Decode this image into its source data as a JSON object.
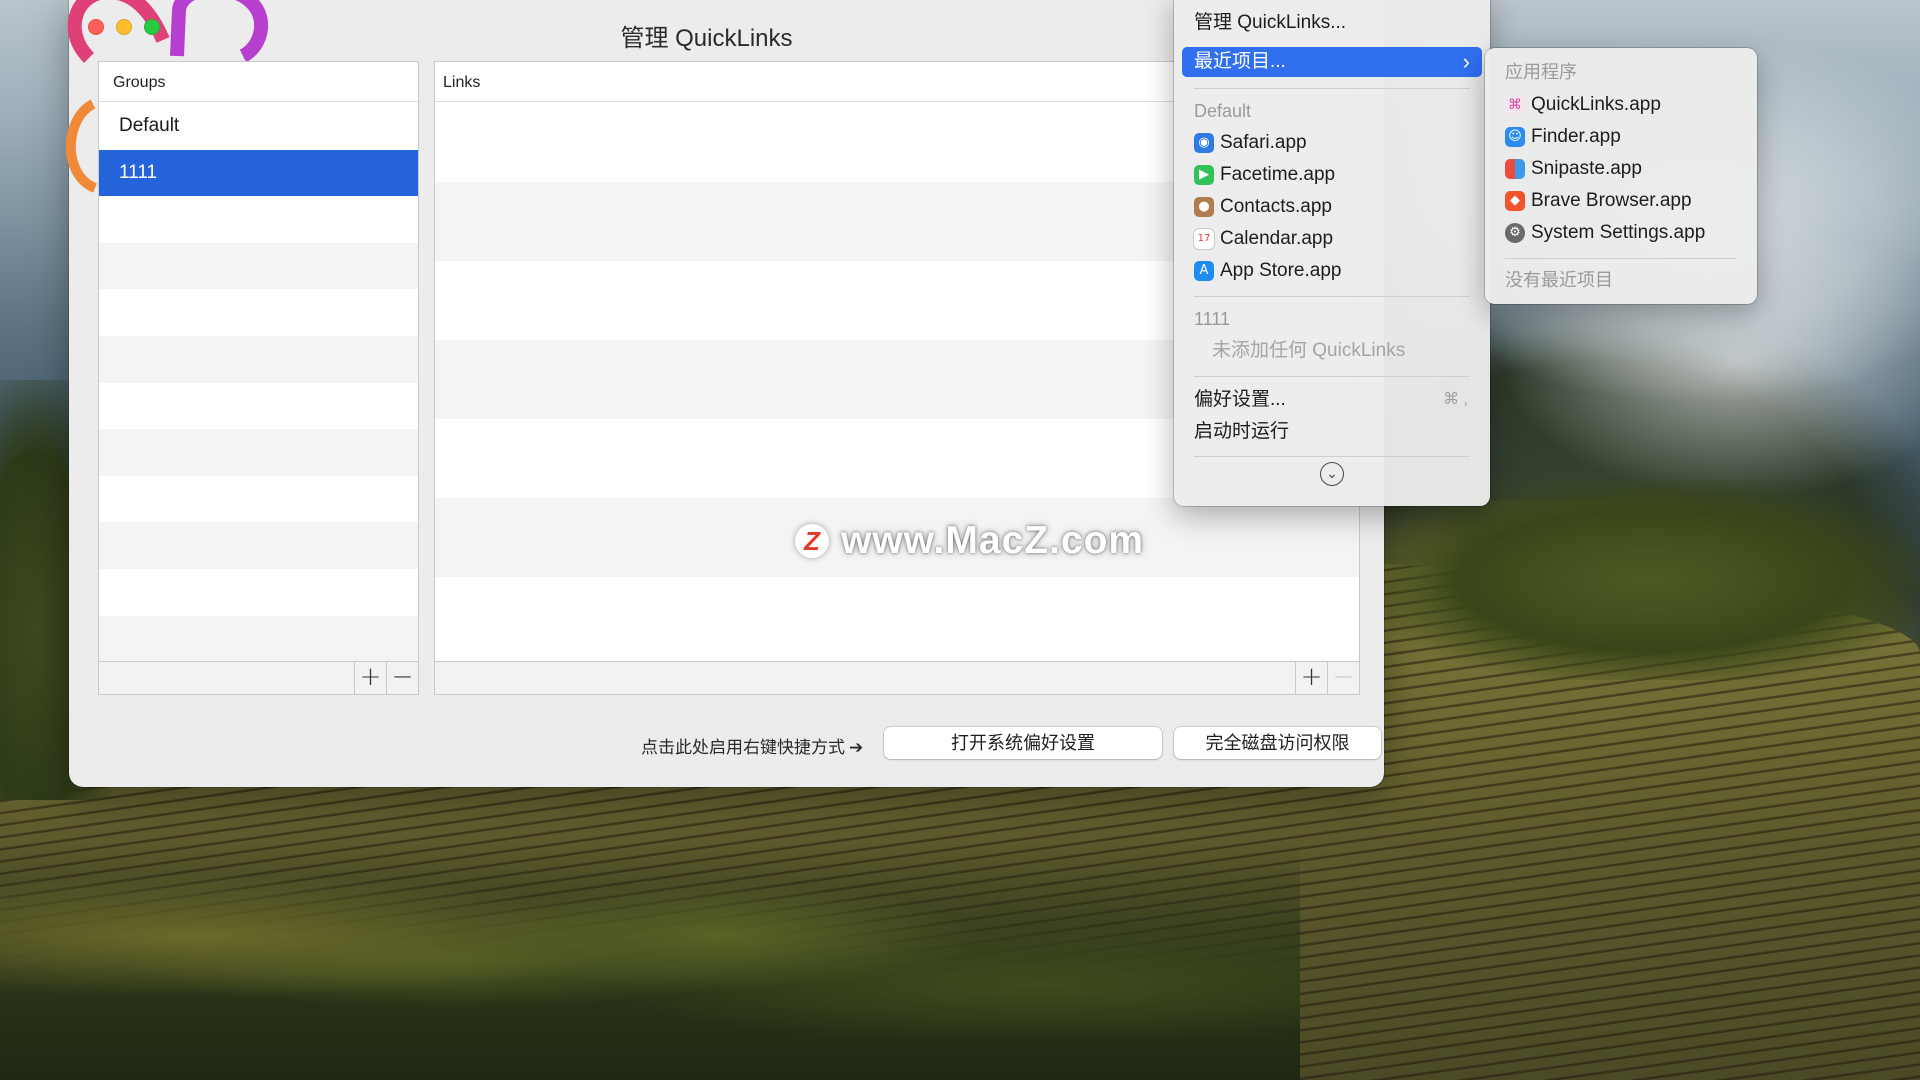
{
  "window": {
    "title": "管理 QuickLinks"
  },
  "groups_panel": {
    "header": "Groups",
    "items": [
      "Default",
      "1111"
    ],
    "selected_index": 1,
    "add_label": "+",
    "remove_label": "−"
  },
  "links_panel": {
    "header": "Links",
    "add_label": "+",
    "remove_label": "−"
  },
  "footer": {
    "hint": "点击此处启用右键快捷方式",
    "hint_arrow": "➔",
    "open_prefs_button": "打开系统偏好设置",
    "disk_access_button": "完全磁盘访问权限"
  },
  "watermark": {
    "logo": "Z",
    "text": "www.MacZ.com"
  },
  "main_menu": {
    "manage": "管理 QuickLinks...",
    "recent": "最近项目...",
    "recent_chevron": "›",
    "group_default": "Default",
    "default_apps": [
      {
        "label": "Safari.app",
        "icon": "safari-icon",
        "color": "#2d7be3"
      },
      {
        "label": "Facetime.app",
        "icon": "facetime-icon",
        "color": "#33c25a"
      },
      {
        "label": "Contacts.app",
        "icon": "contacts-icon",
        "color": "#b07d4e"
      },
      {
        "label": "Calendar.app",
        "icon": "calendar-icon",
        "color": "#ffffff"
      },
      {
        "label": "App Store.app",
        "icon": "app-store-icon",
        "color": "#1e8cf0"
      }
    ],
    "group_1111": "1111",
    "empty_group": "未添加任何 QuickLinks",
    "preferences": "偏好设置...",
    "preferences_shortcut": "⌘ ,",
    "launch_at_login": "启动时运行",
    "more_icon": "chevron-down-circle-icon"
  },
  "sub_menu": {
    "header": "应用程序",
    "apps": [
      {
        "label": "QuickLinks.app",
        "icon": "quicklinks-icon",
        "color": "#d9479c"
      },
      {
        "label": "Finder.app",
        "icon": "finder-icon",
        "color": "#2d8cf0"
      },
      {
        "label": "Snipaste.app",
        "icon": "snipaste-icon",
        "color": "#ea4d3d"
      },
      {
        "label": "Brave Browser.app",
        "icon": "brave-icon",
        "color": "#f0542d"
      },
      {
        "label": "System Settings.app",
        "icon": "system-settings-icon",
        "color": "#6a6a6a"
      }
    ],
    "no_recent": "没有最近项目"
  },
  "colors": {
    "selection": "#2463d9",
    "menu_highlight": "#2f6ff0",
    "traffic_red": "#ff5f57",
    "traffic_yellow": "#febc2e",
    "traffic_green": "#28c840"
  }
}
